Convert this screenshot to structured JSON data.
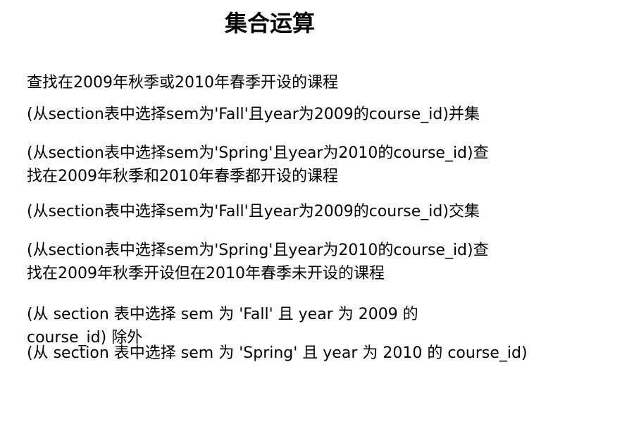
{
  "page": {
    "title": "集合运算",
    "lines": [
      "查找在2009年秋季或2010年春季开设的课程",
      "(从section表中选择sem为'Fall'且year为2009的course_id)并集",
      "(从section表中选择sem为'Spring'且year为2010的course_id)查",
      "找在2009年秋季和2010年春季都开设的课程",
      "(从section表中选择sem为'Fall'且year为2009的course_id)交集",
      "(从section表中选择sem为'Spring'且year为2010的course_id)查",
      "找在2009年秋季开设但在2010年春季未开设的课程",
      "(从 section 表中选择 sem 为 'Fall' 且 year 为 2009 的",
      "course_id) 除外",
      "(从 section 表中选择 sem 为 'Spring' 且 year 为 2010 的 course_id)"
    ]
  }
}
